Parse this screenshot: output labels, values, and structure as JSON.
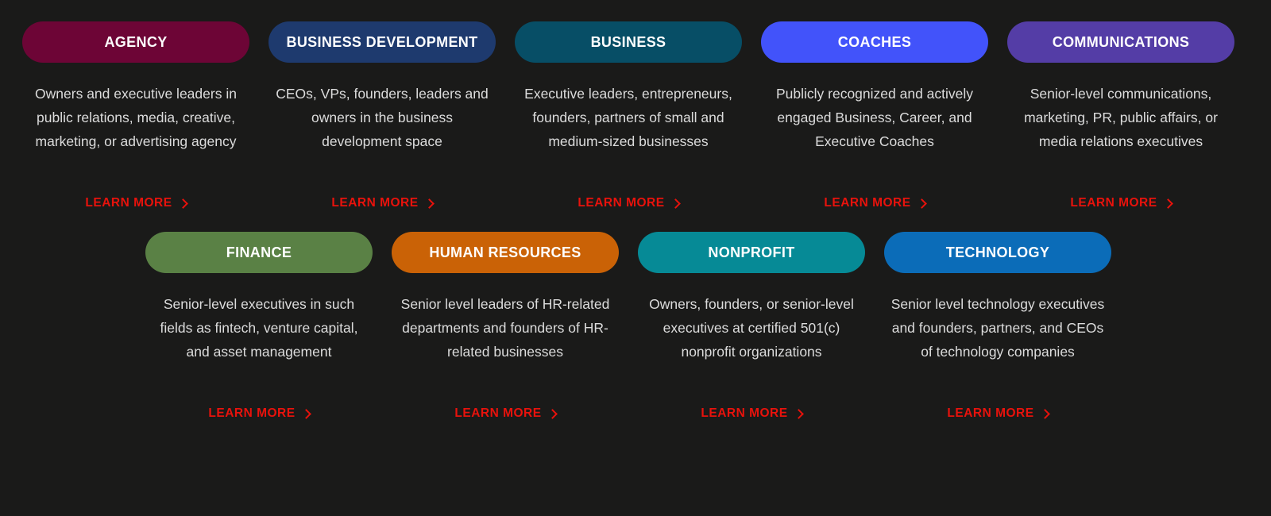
{
  "page": {
    "background_color": "#1a1a19",
    "link_color": "#e8120c",
    "body_text_color": "#dcdcdc",
    "pill_text_color": "#ffffff",
    "learn_more_label": "LEARN MORE",
    "chevron_icon": "chevron-right-icon"
  },
  "rows": [
    {
      "name": "row-top",
      "cards": [
        {
          "title": "AGENCY",
          "color": "#6d0536",
          "description": "Owners and executive leaders in public relations, media, creative, marketing, or advertising agency",
          "link_label": "LEARN MORE"
        },
        {
          "title": "BUSINESS DEVELOPMENT",
          "color": "#1e3a6e",
          "description": "CEOs, VPs, founders, leaders and owners in the business development space",
          "link_label": "LEARN MORE"
        },
        {
          "title": "BUSINESS",
          "color": "#074e66",
          "description": "Executive leaders, entrepreneurs, founders, partners of small and medium-sized businesses",
          "link_label": "LEARN MORE"
        },
        {
          "title": "COACHES",
          "color": "#4253fa",
          "description": "Publicly recognized and actively engaged Business, Career, and Executive Coaches",
          "link_label": "LEARN MORE"
        },
        {
          "title": "COMMUNICATIONS",
          "color": "#543da6",
          "description": "Senior-level communications, marketing, PR, public affairs, or media relations executives",
          "link_label": "LEARN MORE"
        }
      ]
    },
    {
      "name": "row-bottom",
      "cards": [
        {
          "title": "FINANCE",
          "color": "#5a8145",
          "description": "Senior-level executives in such fields as fintech, venture capital, and asset management",
          "link_label": "LEARN MORE"
        },
        {
          "title": "HUMAN RESOURCES",
          "color": "#ca6206",
          "description": "Senior level leaders of HR-related departments and founders of HR-related businesses",
          "link_label": "LEARN MORE"
        },
        {
          "title": "NONPROFIT",
          "color": "#068a96",
          "description": "Owners, founders, or senior-level executives at certified 501(c) nonprofit organizations",
          "link_label": "LEARN MORE"
        },
        {
          "title": "TECHNOLOGY",
          "color": "#0b6cb8",
          "description": "Senior level technology executives and founders, partners, and CEOs of technology companies",
          "link_label": "LEARN MORE"
        }
      ]
    }
  ]
}
